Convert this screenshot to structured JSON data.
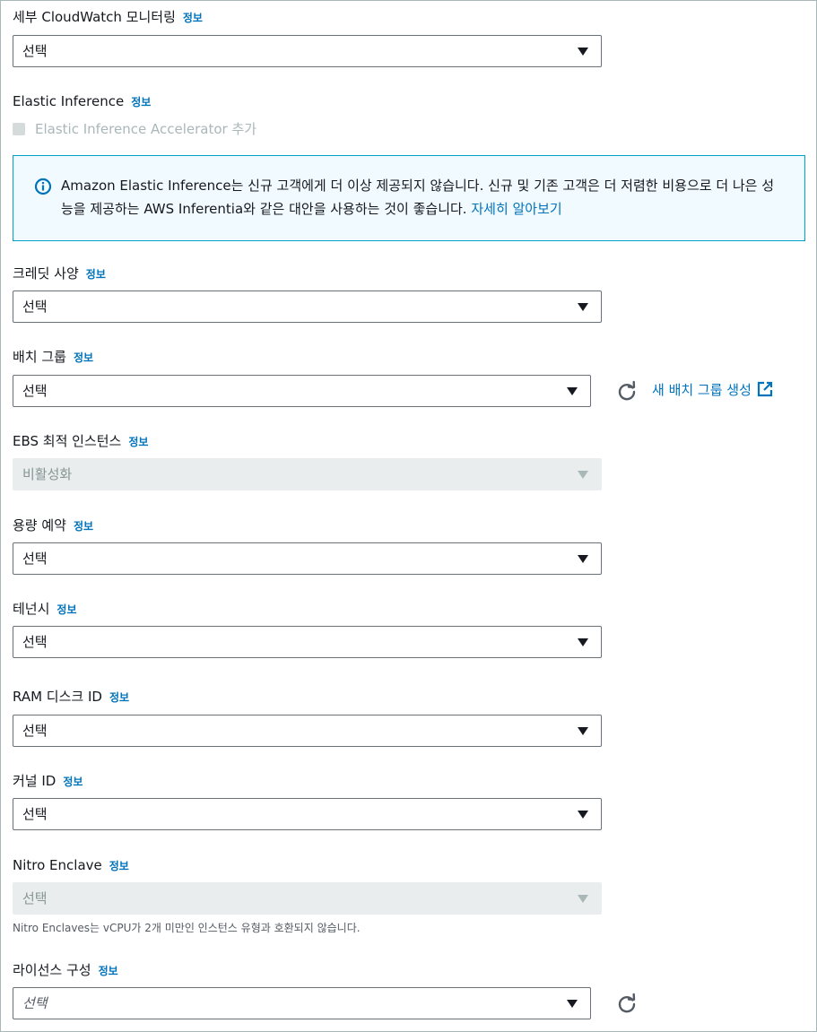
{
  "info_label": "정보",
  "cloudwatch": {
    "label": "세부 CloudWatch 모니터링",
    "value": "선택"
  },
  "elastic_inference": {
    "label": "Elastic Inference",
    "checkbox_label": "Elastic Inference Accelerator 추가",
    "alert_text": "Amazon Elastic Inference는 신규 고객에게 더 이상 제공되지 않습니다. 신규 및 기존 고객은 더 저렴한 비용으로 더 나은 성능을 제공하는 AWS Inferentia와 같은 대안을 사용하는 것이 좋습니다.",
    "alert_link": "자세히 알아보기"
  },
  "credit_spec": {
    "label": "크레딧 사양",
    "value": "선택"
  },
  "placement_group": {
    "label": "배치 그룹",
    "value": "선택",
    "create_link": "새 배치 그룹 생성"
  },
  "ebs_optimized": {
    "label": "EBS 최적 인스턴스",
    "value": "비활성화"
  },
  "capacity_reservation": {
    "label": "용량 예약",
    "value": "선택"
  },
  "tenancy": {
    "label": "테넌시",
    "value": "선택"
  },
  "ram_disk": {
    "label": "RAM 디스크 ID",
    "value": "선택"
  },
  "kernel": {
    "label": "커널 ID",
    "value": "선택"
  },
  "nitro_enclave": {
    "label": "Nitro Enclave",
    "value": "선택",
    "hint": "Nitro Enclaves는 vCPU가 2개 미만인 인스턴스 유형과 호환되지 않습니다."
  },
  "license_config": {
    "label": "라이선스 구성",
    "value": "선택"
  },
  "icons": {
    "dropdown": "caret-down-icon",
    "refresh": "refresh-icon",
    "info": "info-circle-icon",
    "external": "external-link-icon"
  },
  "colors": {
    "link": "#0073bb",
    "alert_bg": "#f1faff",
    "alert_border": "#00a1c9",
    "disabled_bg": "#eaeded"
  }
}
